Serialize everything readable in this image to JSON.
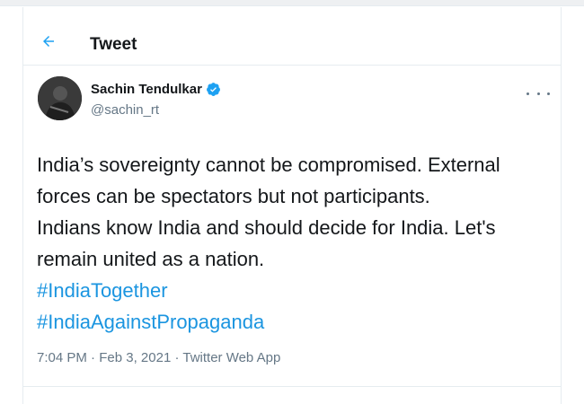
{
  "header": {
    "title": "Tweet",
    "back_icon": "back-arrow-icon"
  },
  "tweet": {
    "author_name": "Sachin Tendulkar",
    "handle": "@sachin_rt",
    "verified_icon": "verified-badge-icon",
    "more_icon": "more-options-icon",
    "text_lines": [
      "India’s sovereignty cannot be compromised. External",
      "forces can be spectators but not participants.",
      "Indians know India and should decide for India. Let's",
      "remain united as a nation."
    ],
    "hashtags": [
      "#IndiaTogether",
      "#IndiaAgainstPropaganda"
    ],
    "time": "7:04 PM",
    "date": "Feb 3, 2021",
    "separator": "·",
    "source": "Twitter Web App"
  },
  "colors": {
    "accent": "#1da1f2",
    "hashtag": "#1b95e0",
    "text": "#14171a",
    "secondary": "#657786",
    "border": "#e6ecf0"
  }
}
